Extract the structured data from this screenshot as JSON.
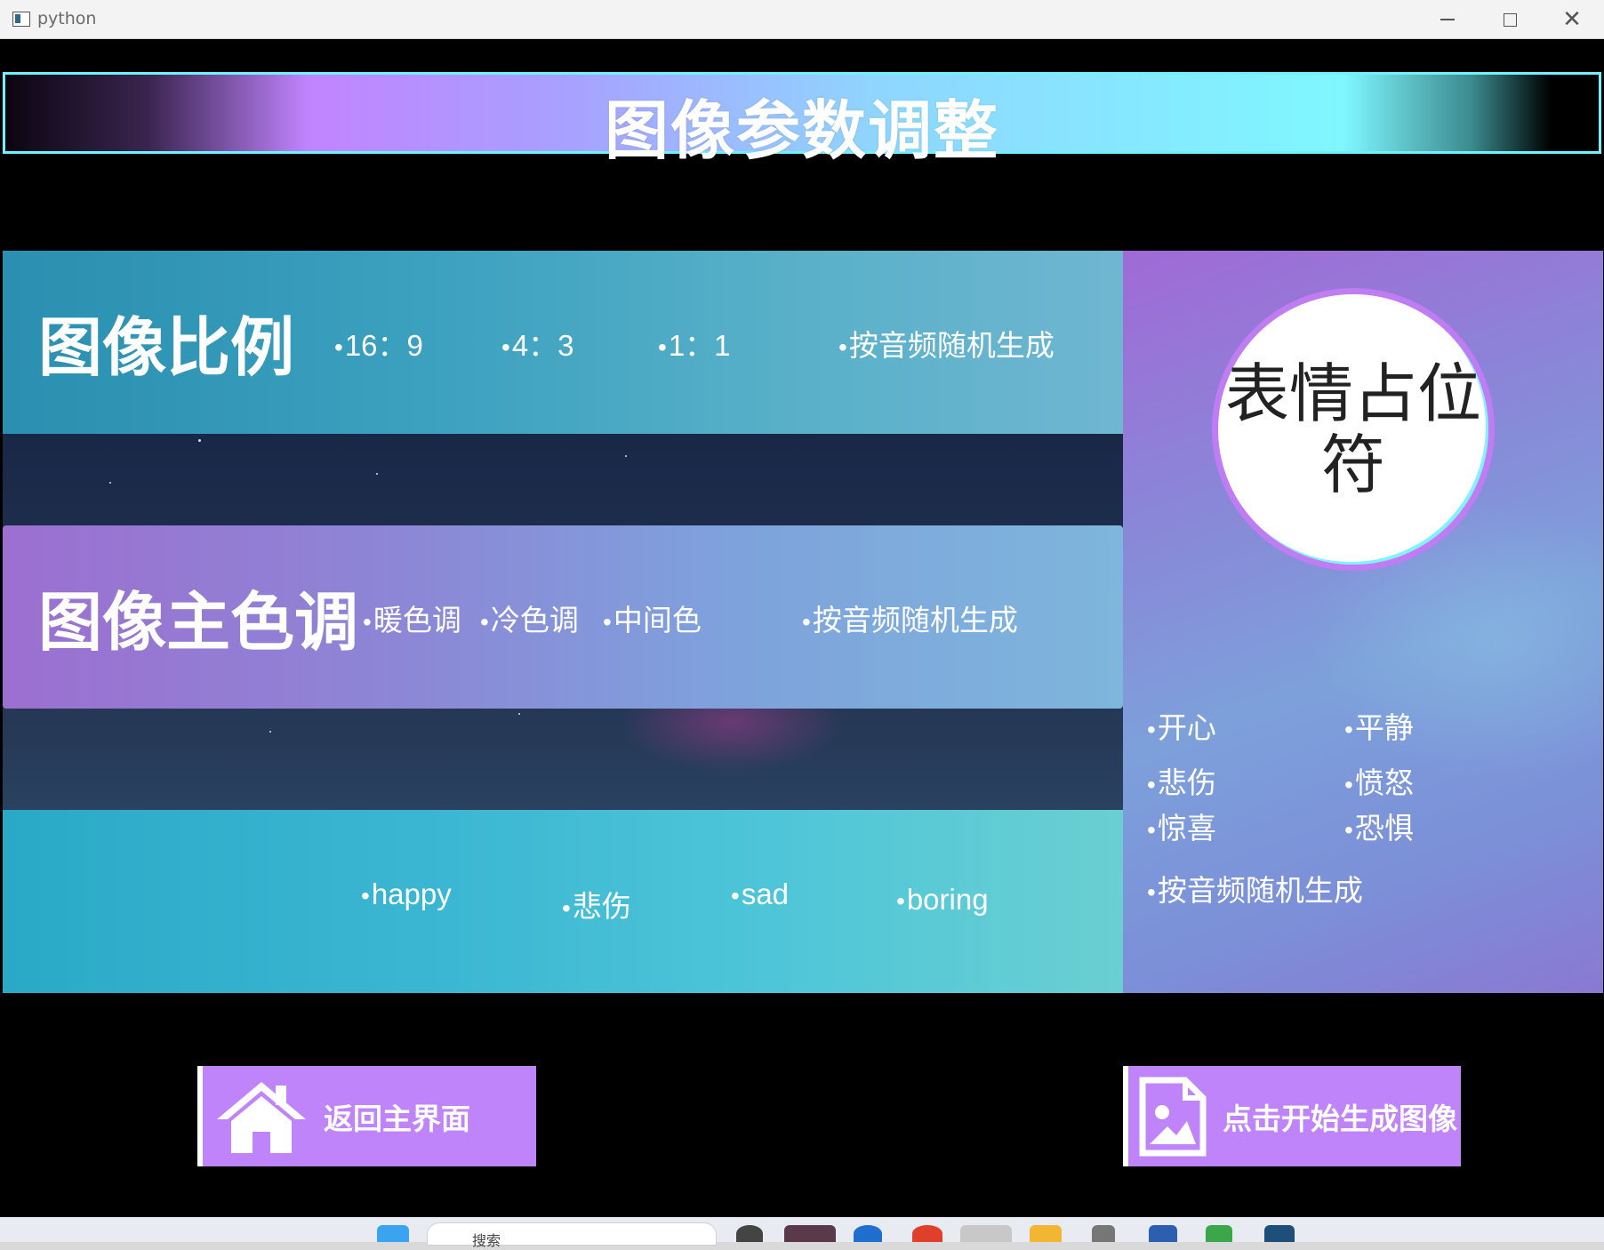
{
  "window": {
    "title": "python"
  },
  "header": {
    "title": "图像参数调整"
  },
  "ratio_panel": {
    "heading": "图像比例",
    "options": [
      "16：9",
      "4：3",
      "1：1",
      "按音频随机生成"
    ]
  },
  "tone_panel": {
    "heading": "图像主色调",
    "options": [
      "暖色调",
      "冷色调",
      "中间色",
      "按音频随机生成"
    ]
  },
  "mood_panel": {
    "options": [
      "happy",
      "悲伤",
      "sad",
      "boring"
    ]
  },
  "emotion_panel": {
    "placeholder": "表情占位符",
    "options": [
      "开心",
      "平静",
      "悲伤",
      "愤怒",
      "惊喜",
      "恐惧",
      "按音频随机生成"
    ]
  },
  "buttons": {
    "home": "返回主界面",
    "generate": "点击开始生成图像"
  },
  "taskbar": {
    "search_text": "搜索"
  },
  "colors": {
    "button_bg": "#c084fa",
    "header_border": "#6ff1ff",
    "avatar_ring": "#c07cf2"
  }
}
